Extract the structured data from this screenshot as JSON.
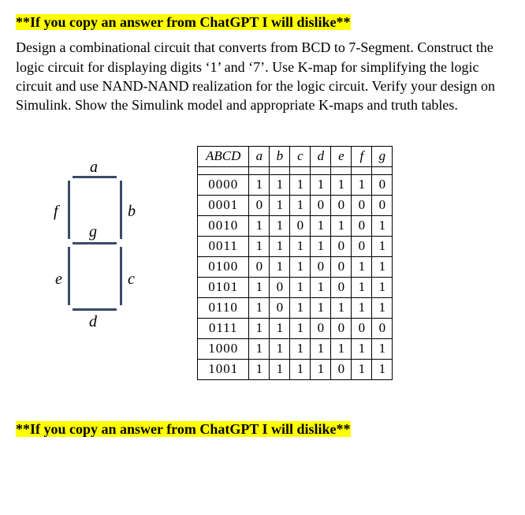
{
  "warning_top": "**If you copy an answer from ChatGPT I will dislike**",
  "question": "Design a combinational circuit that converts from BCD to 7-Segment. Construct the logic circuit for displaying digits ‘1’ and ‘7’. Use K-map for simplifying the logic circuit and use NAND-NAND realization for the logic circuit. Verify your design on Simulink. Show the Simulink model and appropriate K-maps and truth tables.",
  "seven_segment": {
    "labels": {
      "a": "a",
      "b": "b",
      "c": "c",
      "d": "d",
      "e": "e",
      "f": "f",
      "g": "g"
    }
  },
  "truth_table": {
    "headers": [
      "ABCD",
      "a",
      "b",
      "c",
      "d",
      "e",
      "f",
      "g"
    ],
    "rows": [
      {
        "input": "0000",
        "out": [
          "1",
          "1",
          "1",
          "1",
          "1",
          "1",
          "0"
        ]
      },
      {
        "input": "0001",
        "out": [
          "0",
          "1",
          "1",
          "0",
          "0",
          "0",
          "0"
        ]
      },
      {
        "input": "0010",
        "out": [
          "1",
          "1",
          "0",
          "1",
          "1",
          "0",
          "1"
        ]
      },
      {
        "input": "0011",
        "out": [
          "1",
          "1",
          "1",
          "1",
          "0",
          "0",
          "1"
        ]
      },
      {
        "input": "0100",
        "out": [
          "0",
          "1",
          "1",
          "0",
          "0",
          "1",
          "1"
        ]
      },
      {
        "input": "0101",
        "out": [
          "1",
          "0",
          "1",
          "1",
          "0",
          "1",
          "1"
        ]
      },
      {
        "input": "0110",
        "out": [
          "1",
          "0",
          "1",
          "1",
          "1",
          "1",
          "1"
        ]
      },
      {
        "input": "0111",
        "out": [
          "1",
          "1",
          "1",
          "0",
          "0",
          "0",
          "0"
        ]
      },
      {
        "input": "1000",
        "out": [
          "1",
          "1",
          "1",
          "1",
          "1",
          "1",
          "1"
        ]
      },
      {
        "input": "1001",
        "out": [
          "1",
          "1",
          "1",
          "1",
          "0",
          "1",
          "1"
        ]
      }
    ]
  },
  "chart_data": {
    "type": "table",
    "title": "BCD to 7-Segment Truth Table",
    "columns": [
      "ABCD",
      "a",
      "b",
      "c",
      "d",
      "e",
      "f",
      "g"
    ],
    "data": [
      [
        "0000",
        1,
        1,
        1,
        1,
        1,
        1,
        0
      ],
      [
        "0001",
        0,
        1,
        1,
        0,
        0,
        0,
        0
      ],
      [
        "0010",
        1,
        1,
        0,
        1,
        1,
        0,
        1
      ],
      [
        "0011",
        1,
        1,
        1,
        1,
        0,
        0,
        1
      ],
      [
        "0100",
        0,
        1,
        1,
        0,
        0,
        1,
        1
      ],
      [
        "0101",
        1,
        0,
        1,
        1,
        0,
        1,
        1
      ],
      [
        "0110",
        1,
        0,
        1,
        1,
        1,
        1,
        1
      ],
      [
        "0111",
        1,
        1,
        1,
        0,
        0,
        0,
        0
      ],
      [
        "1000",
        1,
        1,
        1,
        1,
        1,
        1,
        1
      ],
      [
        "1001",
        1,
        1,
        1,
        1,
        0,
        1,
        1
      ]
    ]
  },
  "warning_bottom": "**If you copy an answer from ChatGPT I will dislike**"
}
